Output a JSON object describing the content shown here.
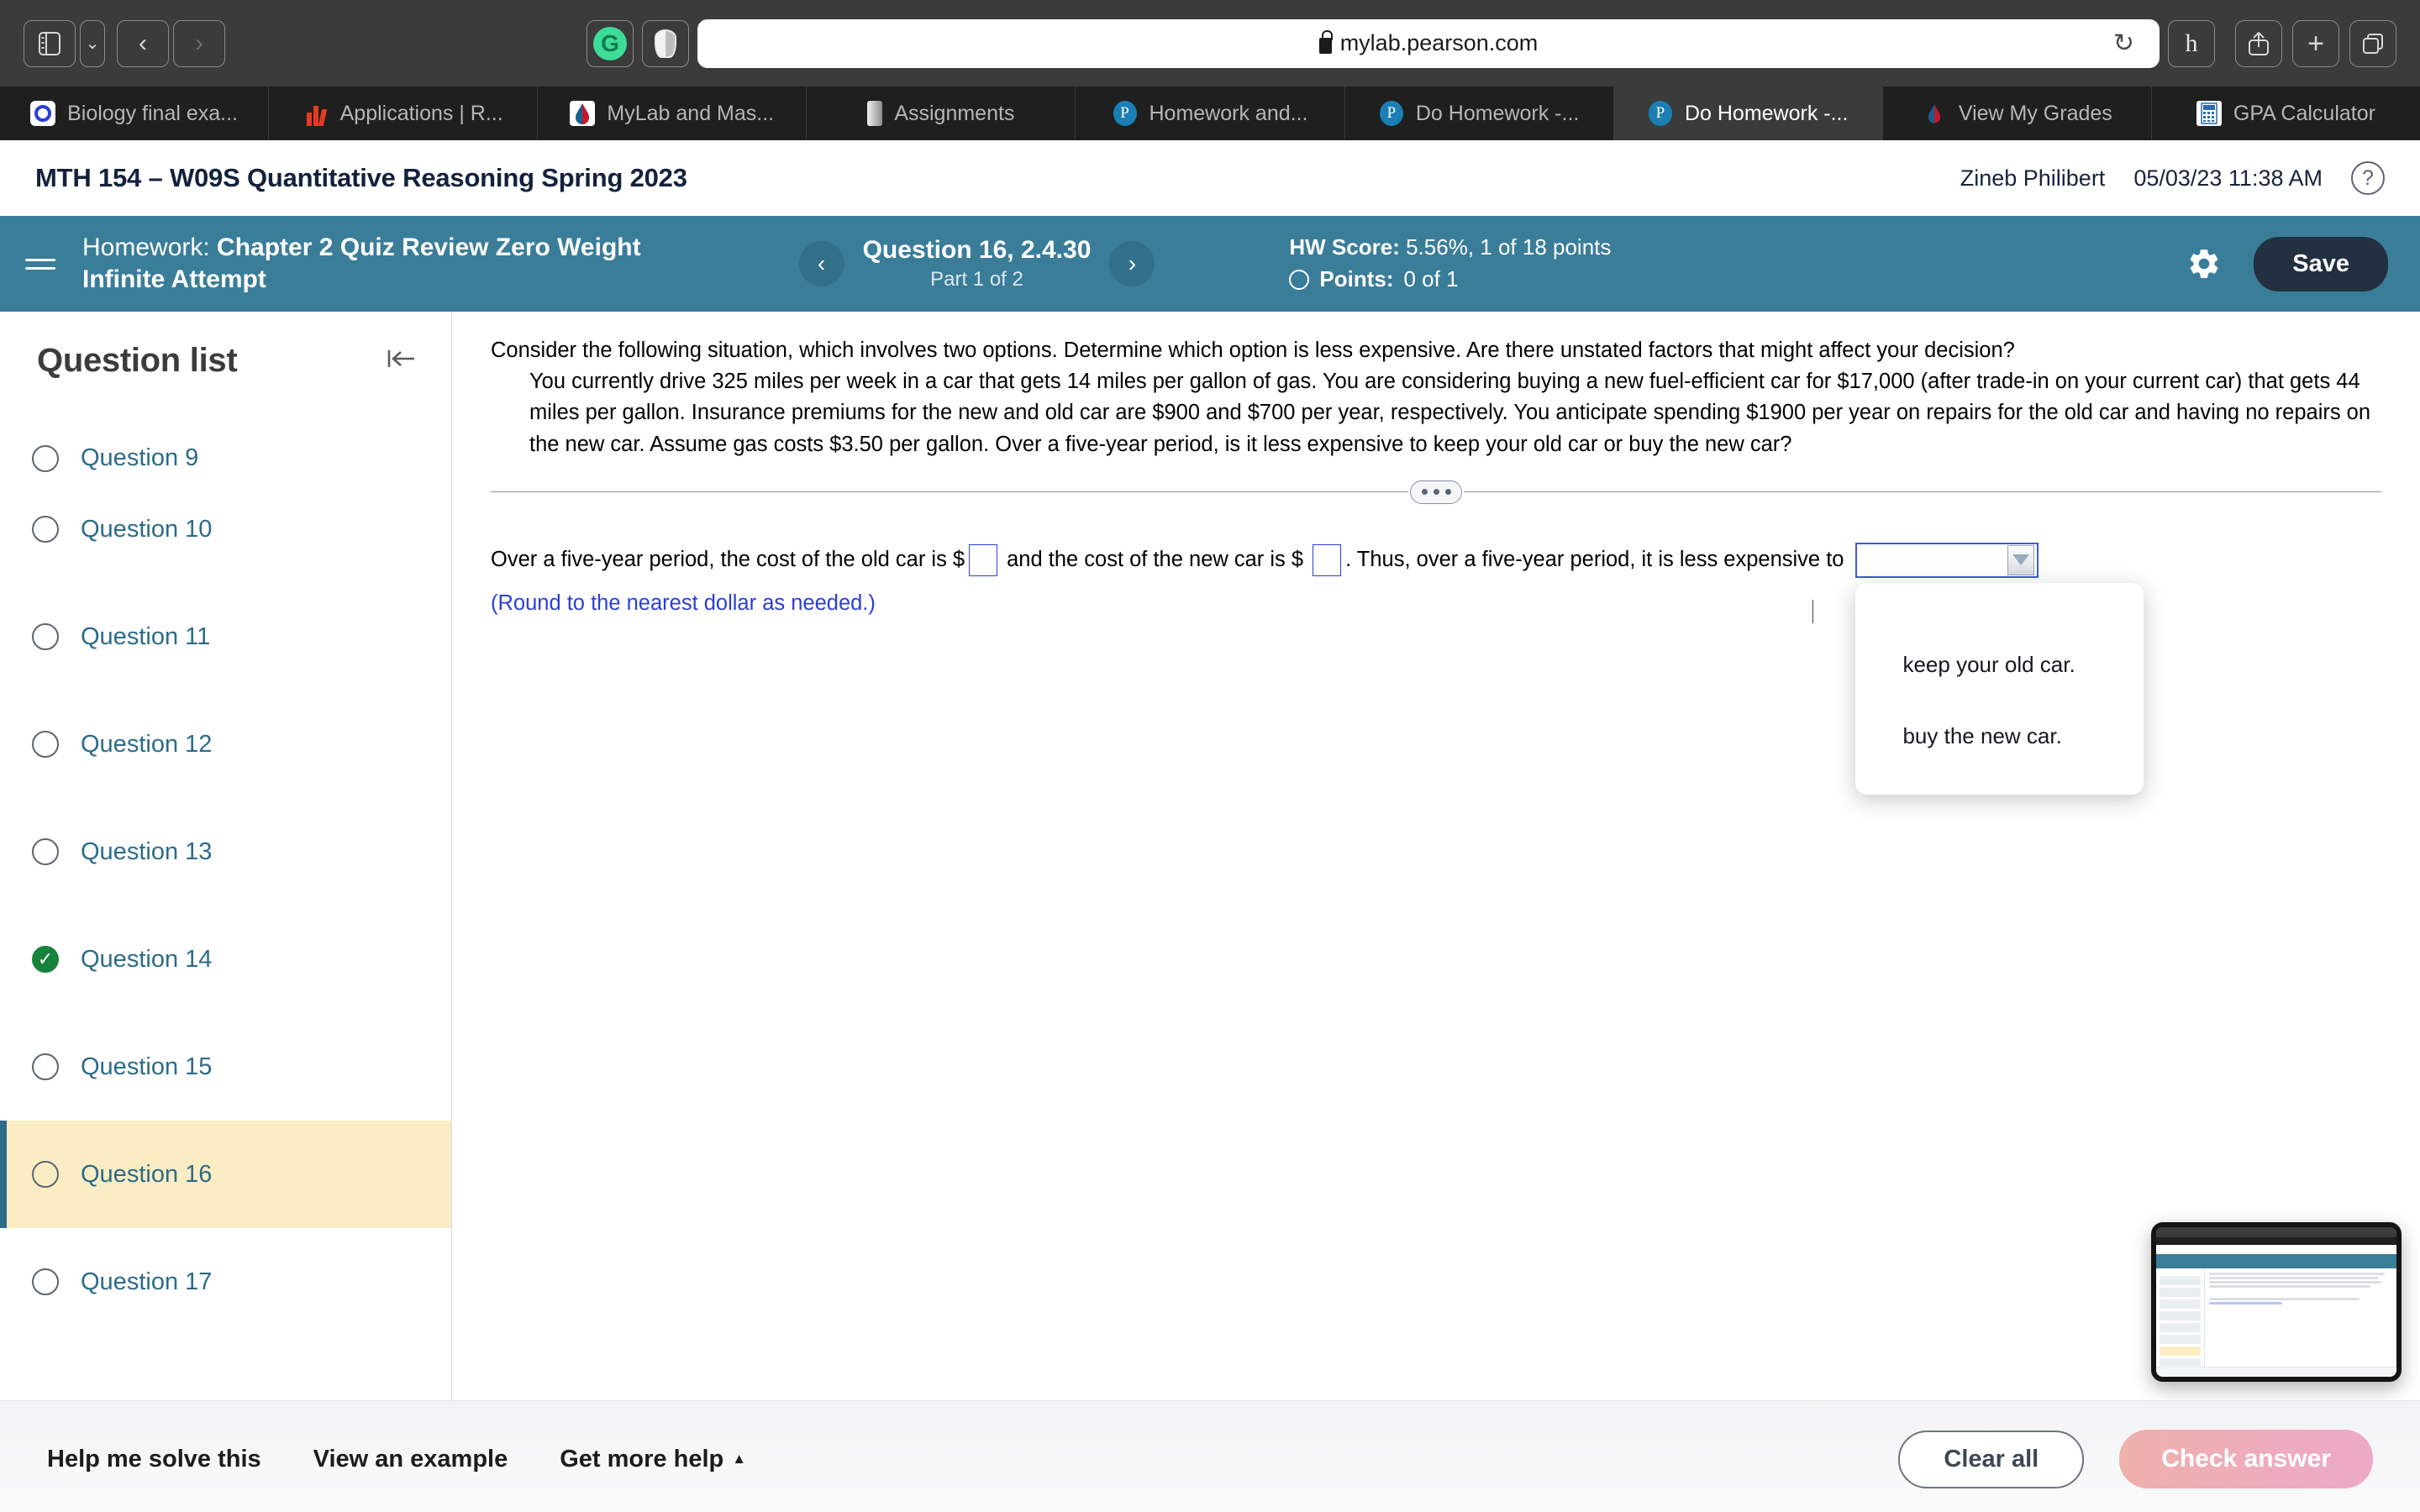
{
  "browser": {
    "url": "mylab.pearson.com",
    "lock_icon": "lock-icon",
    "sidebar_icon": "sidebar-icon",
    "back_icon": "‹",
    "forward_icon": "›",
    "chevron_icon": "⌄",
    "reload_icon": "↻",
    "grammarly_icon": "G",
    "hypothesis_icon": "h",
    "share_icon": "share-icon",
    "newtab_icon": "+",
    "tabs_overview_icon": "tabs-icon",
    "tabs": [
      {
        "label": "Biology final exa...",
        "icon": "biology-favicon",
        "active": false
      },
      {
        "label": "Applications | R...",
        "icon": "applications-favicon",
        "active": false
      },
      {
        "label": "MyLab and Mas...",
        "icon": "mylab-favicon",
        "active": false
      },
      {
        "label": "Assignments",
        "icon": "assignments-favicon",
        "active": false
      },
      {
        "label": "Homework and...",
        "icon": "pearson-favicon",
        "active": false
      },
      {
        "label": "Do Homework -...",
        "icon": "pearson-favicon",
        "active": false
      },
      {
        "label": "Do Homework -...",
        "icon": "pearson-favicon",
        "active": true
      },
      {
        "label": "View My Grades",
        "icon": "grades-favicon",
        "active": false
      },
      {
        "label": "GPA Calculator",
        "icon": "gpa-favicon",
        "active": false
      }
    ]
  },
  "header": {
    "course_title": "MTH 154 – W09S Quantitative Reasoning Spring 2023",
    "user_name": "Zineb Philibert",
    "datetime": "05/03/23 11:38 AM",
    "help_icon": "?"
  },
  "toolbar": {
    "menu_icon": "hamburger-icon",
    "homework_label": "Homework:",
    "homework_name": "Chapter 2 Quiz Review Zero Weight",
    "homework_sub": "Infinite Attempt",
    "prev_icon": "‹",
    "next_icon": "›",
    "question_title": "Question 16, 2.4.30",
    "question_part": "Part 1 of 2",
    "hw_score_label": "HW Score:",
    "hw_score_value": "5.56%, 1 of 18 points",
    "points_label": "Points:",
    "points_value": "0 of 1",
    "settings_icon": "gear-icon",
    "save_label": "Save"
  },
  "question_list": {
    "title": "Question list",
    "collapse_icon": "collapse-left-icon",
    "items": [
      {
        "label": "Question 9",
        "state": "todo",
        "current": false
      },
      {
        "label": "Question 10",
        "state": "todo",
        "current": false
      },
      {
        "label": "Question 11",
        "state": "todo",
        "current": false
      },
      {
        "label": "Question 12",
        "state": "todo",
        "current": false
      },
      {
        "label": "Question 13",
        "state": "todo",
        "current": false
      },
      {
        "label": "Question 14",
        "state": "correct",
        "current": false
      },
      {
        "label": "Question 15",
        "state": "todo",
        "current": false
      },
      {
        "label": "Question 16",
        "state": "todo",
        "current": true
      },
      {
        "label": "Question 17",
        "state": "todo",
        "current": false
      }
    ],
    "check_glyph": "✓"
  },
  "question": {
    "prompt": "Consider the following situation, which involves two options. Determine which option is less expensive. Are there unstated factors that might affect your decision?",
    "body": "You currently drive 325 miles per week in a car that gets 14 miles per gallon of gas. You are considering buying a new fuel-efficient car for $17,000 (after trade-in on your current car) that gets 44 miles per gallon. Insurance premiums for the new and old car are $900 and $700 per year, respectively. You anticipate spending $1900 per year on repairs for the old car and having no repairs on the new car. Assume gas costs $3.50 per gallon. Over a five-year period, is it less expensive to keep your old car or buy the new car?",
    "divider_icon": "drag-handle-dots"
  },
  "answer": {
    "text_part1": "Over a five-year period, the cost of the old car is $",
    "text_part2": "and the cost of the new car is $",
    "text_part3": ". Thus, over a five-year period, it is less expensive to",
    "old_car_value": "",
    "new_car_value": "",
    "round_note": "(Round to the nearest dollar as needed.)",
    "select_value": "",
    "dropdown_arrow_icon": "chevron-down-icon",
    "dropdown_options": [
      "",
      "keep your old car.",
      "buy the new car."
    ]
  },
  "footer": {
    "help_me_solve": "Help me solve this",
    "view_example": "View an example",
    "get_more_help": "Get more help",
    "get_more_help_caret": "▲",
    "clear_all": "Clear all",
    "check_answer": "Check answer"
  },
  "thumbnail": {
    "name": "screenshot-thumbnail"
  },
  "colors": {
    "accent_blue": "#3a7d99",
    "link_blue": "#2c6b8a",
    "highlight_yellow": "#faedc4",
    "correct_green": "#17823b",
    "field_blue": "#2b3fd6",
    "check_pink": "#eda9c9"
  }
}
